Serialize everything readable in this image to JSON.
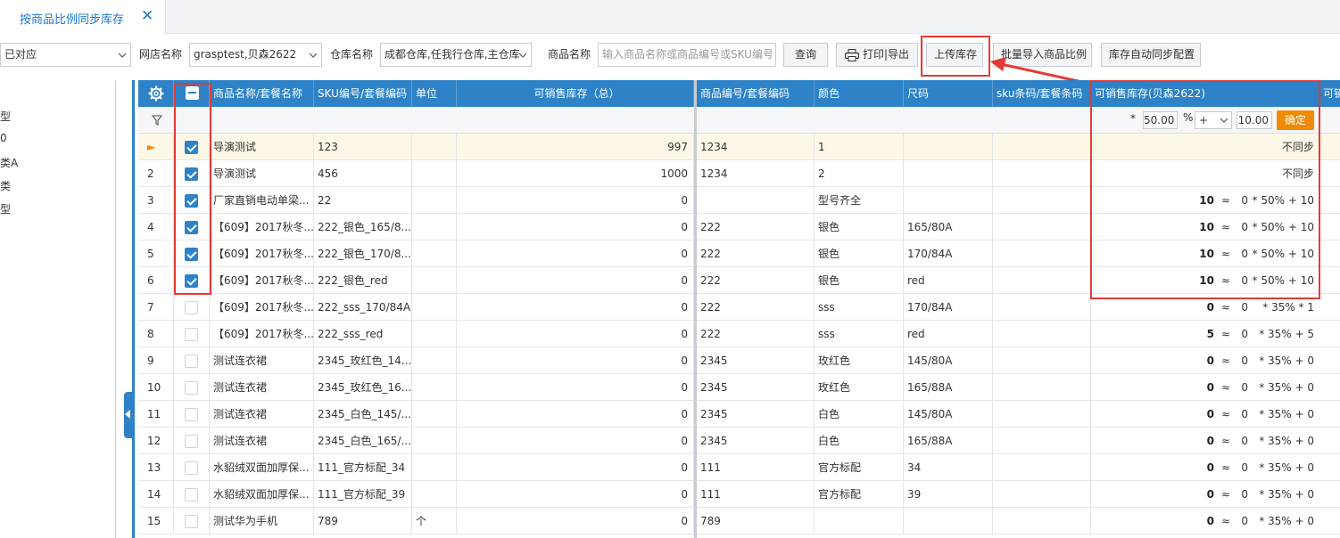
{
  "tab": {
    "label": "按商品比例同步库存",
    "close": "✕"
  },
  "toolbar": {
    "match_select": "已对应",
    "shop_label": "网店名称",
    "shop_value": "grasptest,贝森2622",
    "warehouse_label": "仓库名称",
    "warehouse_value": "成都仓库,任我行仓库,主仓库",
    "product_label": "商品名称",
    "product_placeholder": "输入商品名称或商品编号或SKU编号",
    "query_button": "查询",
    "print_button": "打印|导出",
    "upload_button": "上传库存",
    "import_button": "批量导入商品比例",
    "auto_sync_button": "库存自动同步配置"
  },
  "left_panel": {
    "items": [
      "型",
      "0",
      "类A",
      "分类",
      "型"
    ]
  },
  "grid": {
    "columns": {
      "name": "商品名称/套餐名称",
      "sku": "SKU编号/套餐编码",
      "unit": "单位",
      "total": "可销售库存（总）",
      "code": "商品编号/套餐编码",
      "color": "颜色",
      "size": "尺码",
      "barcode": "sku条码/套餐条码",
      "shop_stock": "可销售库存(贝森2622)",
      "extra": "可销"
    },
    "filter": {
      "star": "*",
      "percent_value": "50.00",
      "percent_sign": "%",
      "op": "+",
      "add_value": "10.00",
      "confirm": "确定"
    },
    "rows": [
      {
        "n": "►",
        "checked": true,
        "name": "导演测试",
        "sku": "123",
        "unit": "",
        "total": "997",
        "code": "1234",
        "color": "1",
        "size": "",
        "barcode": "",
        "nosync": "不同步",
        "sel": true
      },
      {
        "n": "2",
        "checked": true,
        "name": "导演测试",
        "sku": "456",
        "unit": "",
        "total": "1000",
        "code": "1234",
        "color": "2",
        "size": "",
        "barcode": "",
        "nosync": "不同步"
      },
      {
        "n": "3",
        "checked": true,
        "name": "厂家直销电动单梁...",
        "sku": "22",
        "unit": "",
        "total": "0",
        "code": "",
        "color": "型号齐全",
        "size": "",
        "barcode": "",
        "sv": "10",
        "approx": "≈",
        "zero": "0",
        "formula": "* 50% + 10"
      },
      {
        "n": "4",
        "checked": true,
        "name": "【609】2017秋冬...",
        "sku": "222_银色_165/8...",
        "unit": "",
        "total": "0",
        "code": "222",
        "color": "银色",
        "size": "165/80A",
        "barcode": "",
        "sv": "10",
        "approx": "≈",
        "zero": "0",
        "formula": "* 50% + 10"
      },
      {
        "n": "5",
        "checked": true,
        "name": "【609】2017秋冬...",
        "sku": "222_银色_170/8...",
        "unit": "",
        "total": "0",
        "code": "222",
        "color": "银色",
        "size": "170/84A",
        "barcode": "",
        "sv": "10",
        "approx": "≈",
        "zero": "0",
        "formula": "* 50% + 10"
      },
      {
        "n": "6",
        "checked": true,
        "name": "【609】2017秋冬...",
        "sku": "222_银色_red",
        "unit": "",
        "total": "0",
        "code": "222",
        "color": "银色",
        "size": "red",
        "barcode": "",
        "sv": "10",
        "approx": "≈",
        "zero": "0",
        "formula": "* 50% + 10"
      },
      {
        "n": "7",
        "checked": false,
        "name": "【609】2017秋冬...",
        "sku": "222_sss_170/84A",
        "unit": "",
        "total": "0",
        "code": "222",
        "color": "sss",
        "size": "170/84A",
        "barcode": "",
        "sv": "0",
        "approx": "≈",
        "zero": "0",
        "formula": "* 35% * 1"
      },
      {
        "n": "8",
        "checked": false,
        "name": "【609】2017秋冬...",
        "sku": "222_sss_red",
        "unit": "",
        "total": "0",
        "code": "222",
        "color": "sss",
        "size": "red",
        "barcode": "",
        "sv": "5",
        "approx": "≈",
        "zero": "0",
        "formula": "* 35% + 5"
      },
      {
        "n": "9",
        "checked": false,
        "name": "测试连衣裙",
        "sku": "2345_玫红色_14...",
        "unit": "",
        "total": "0",
        "code": "2345",
        "color": "玫红色",
        "size": "145/80A",
        "barcode": "",
        "sv": "0",
        "approx": "≈",
        "zero": "0",
        "formula": "* 35% + 0"
      },
      {
        "n": "10",
        "checked": false,
        "name": "测试连衣裙",
        "sku": "2345_玫红色_16...",
        "unit": "",
        "total": "0",
        "code": "2345",
        "color": "玫红色",
        "size": "165/88A",
        "barcode": "",
        "sv": "0",
        "approx": "≈",
        "zero": "0",
        "formula": "* 35% + 0"
      },
      {
        "n": "11",
        "checked": false,
        "name": "测试连衣裙",
        "sku": "2345_白色_145/...",
        "unit": "",
        "total": "0",
        "code": "2345",
        "color": "白色",
        "size": "145/80A",
        "barcode": "",
        "sv": "0",
        "approx": "≈",
        "zero": "0",
        "formula": "* 35% + 0"
      },
      {
        "n": "12",
        "checked": false,
        "name": "测试连衣裙",
        "sku": "2345_白色_165/...",
        "unit": "",
        "total": "0",
        "code": "2345",
        "color": "白色",
        "size": "165/88A",
        "barcode": "",
        "sv": "0",
        "approx": "≈",
        "zero": "0",
        "formula": "* 35% + 0"
      },
      {
        "n": "13",
        "checked": false,
        "name": "水貂绒双面加厚保...",
        "sku": "111_官方标配_34",
        "unit": "",
        "total": "0",
        "code": "111",
        "color": "官方标配",
        "size": "34",
        "barcode": "",
        "sv": "0",
        "approx": "≈",
        "zero": "0",
        "formula": "* 35% + 0"
      },
      {
        "n": "14",
        "checked": false,
        "name": "水貂绒双面加厚保...",
        "sku": "111_官方标配_39",
        "unit": "",
        "total": "0",
        "code": "111",
        "color": "官方标配",
        "size": "39",
        "barcode": "",
        "sv": "0",
        "approx": "≈",
        "zero": "0",
        "formula": "* 35% + 0"
      },
      {
        "n": "15",
        "checked": false,
        "name": "测试华为手机",
        "sku": "789",
        "unit": "个",
        "total": "0",
        "code": "789",
        "color": "",
        "size": "",
        "barcode": "",
        "sv": "0",
        "approx": "≈",
        "zero": "0",
        "formula": "* 35% + 0"
      }
    ]
  },
  "colors": {
    "accent": "#2d82c8",
    "highlight": "#e53935",
    "confirm": "#f08a00"
  }
}
